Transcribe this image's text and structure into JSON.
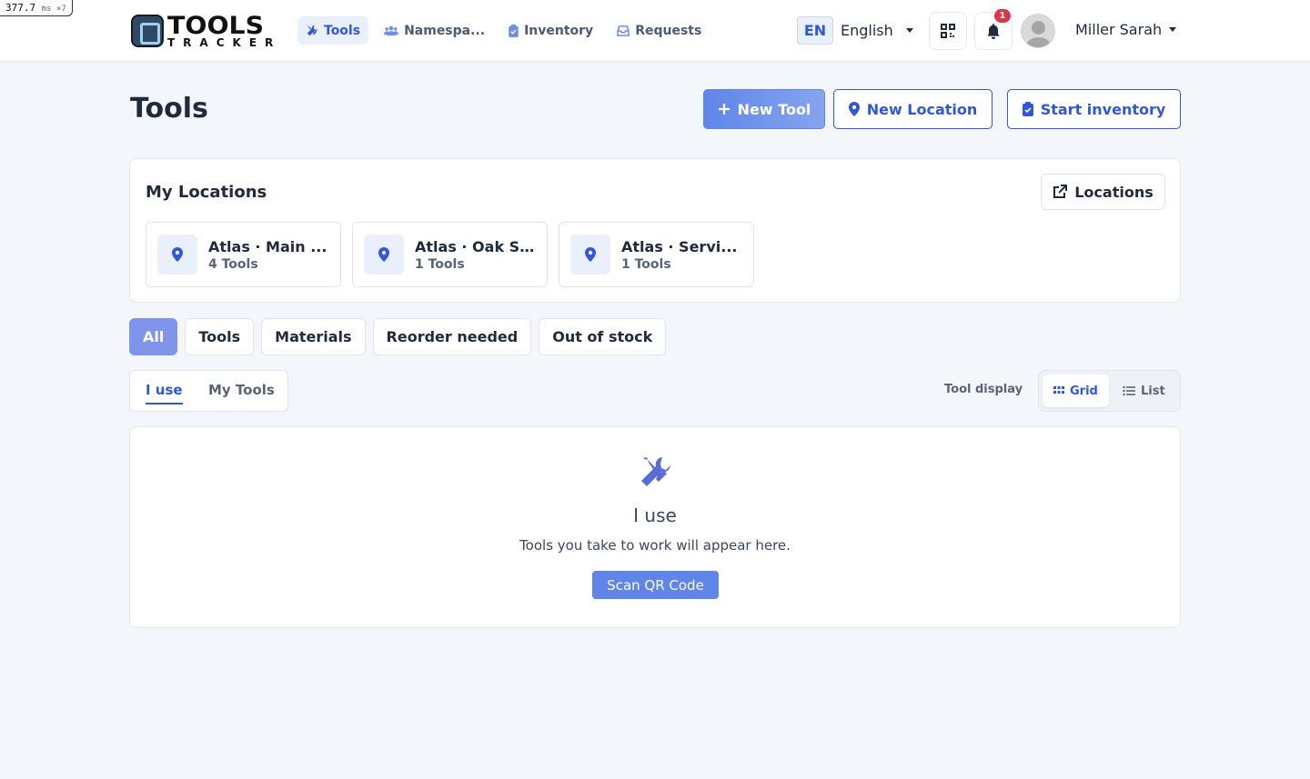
{
  "perf": {
    "value": "377.7",
    "unit": "ms ×7"
  },
  "brand": {
    "top": "TOOLS",
    "bottom": "TRACKER"
  },
  "nav": [
    {
      "label": "Tools",
      "icon": "wrench-screwdriver-icon"
    },
    {
      "label": "Namespa...",
      "icon": "users-icon"
    },
    {
      "label": "Inventory",
      "icon": "clipboard-check-icon"
    },
    {
      "label": "Requests",
      "icon": "inbox-icon"
    }
  ],
  "language": {
    "code": "EN",
    "name": "English"
  },
  "notifications": {
    "count": "1"
  },
  "user": {
    "name": "Miller Sarah"
  },
  "page": {
    "title": "Tools",
    "new_tool": "New Tool",
    "new_location": "New Location",
    "start_inventory": "Start inventory"
  },
  "locations": {
    "title": "My Locations",
    "link_label": "Locations",
    "items": [
      {
        "name": "Atlas · Main ...",
        "count": "4 Tools"
      },
      {
        "name": "Atlas · Oak S...",
        "count": "1 Tools"
      },
      {
        "name": "Atlas · Servi...",
        "count": "1 Tools"
      }
    ]
  },
  "filters": [
    "All",
    "Tools",
    "Materials",
    "Reorder needed",
    "Out of stock"
  ],
  "subtabs": [
    "I use",
    "My Tools"
  ],
  "display": {
    "label": "Tool display",
    "grid": "Grid",
    "list": "List"
  },
  "empty": {
    "title": "I use",
    "subtitle": "Tools you take to work will appear here.",
    "action": "Scan QR Code"
  },
  "colors": {
    "accent": "#2f57d8",
    "primary_button": "#5f85e8",
    "badge": "#dc3545",
    "filter_active": "#8194ec"
  }
}
